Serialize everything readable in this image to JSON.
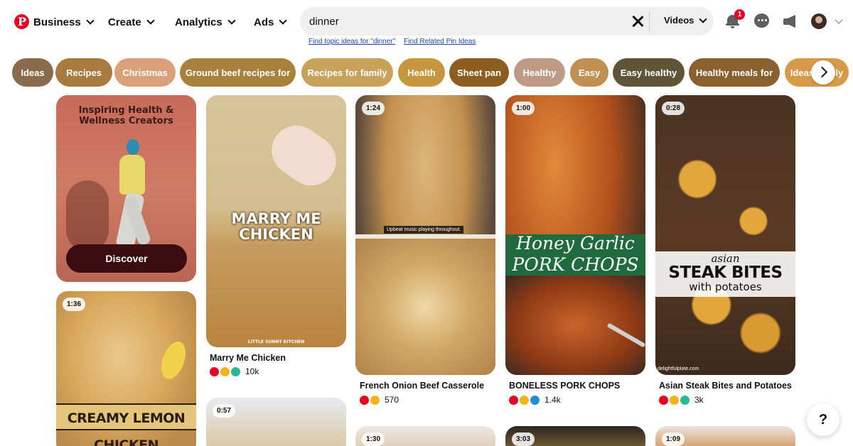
{
  "nav": {
    "business": "Business",
    "create": "Create",
    "analytics": "Analytics",
    "ads": "Ads"
  },
  "search": {
    "value": "dinner",
    "filter": "Videos",
    "link_topic": "Find topic ideas for \"dinner\"",
    "link_related": "Find Related Pin Ideas"
  },
  "notifications": {
    "count": "1"
  },
  "chips": [
    {
      "label": "Ideas",
      "color": "#8a6b4c"
    },
    {
      "label": "Recipes",
      "color": "#a97a3d"
    },
    {
      "label": "Christmas",
      "color": "#d9a07a"
    },
    {
      "label": "Ground beef recipes for",
      "color": "#a8823c"
    },
    {
      "label": "Recipes for family",
      "color": "#c9a25a"
    },
    {
      "label": "Health",
      "color": "#c7973e"
    },
    {
      "label": "Sheet pan",
      "color": "#8c5d1f"
    },
    {
      "label": "Healthy",
      "color": "#bf9a86"
    },
    {
      "label": "Easy",
      "color": "#c28f52"
    },
    {
      "label": "Easy healthy",
      "color": "#5e5438"
    },
    {
      "label": "Healthy meals for",
      "color": "#8a6030"
    },
    {
      "label": "Ideas family",
      "color": "#d79a48"
    }
  ],
  "pins": {
    "promo": {
      "line1": "Inspiring Health &",
      "line2": "Wellness Creators",
      "button": "Discover"
    },
    "marry_me": {
      "overlay1": "MARRY ME",
      "overlay2": "CHICKEN",
      "brand": "LITTLE SUNNY KITCHEN",
      "title": "Marry Me Chicken",
      "count": "10k"
    },
    "casserole": {
      "duration": "1:24",
      "caption": "Upbeat music playing throughout.",
      "title": "French Onion Beef Casserole",
      "count": "570"
    },
    "pork": {
      "duration": "1:00",
      "overlay1": "Honey Garlic",
      "overlay2": "PORK CHOPS",
      "title": "BONELESS PORK CHOPS",
      "count": "1.4k"
    },
    "steak": {
      "duration": "0:28",
      "overlay1": "asian",
      "overlay2": "STEAK BITES",
      "overlay3": "with potatoes",
      "watermark": "delightfulplate.com",
      "title": "Asian Steak Bites and Potatoes",
      "count": "3k"
    },
    "lemon": {
      "duration": "1:36",
      "overlay": "CREAMY LEMON CHICKEN"
    },
    "row2_b": {
      "duration": "0:57"
    },
    "row2_c": {
      "duration": "1:30"
    },
    "row2_d": {
      "duration": "3:03"
    },
    "row2_e": {
      "duration": "1:09"
    }
  },
  "help": {
    "label": "?"
  }
}
